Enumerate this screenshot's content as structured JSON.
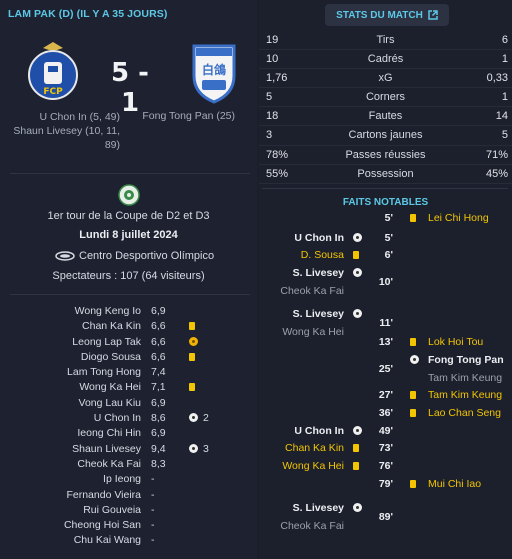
{
  "match": {
    "header": "LAM PAK (D) (IL Y A 35 JOURS)",
    "score": "5 - 1",
    "home_scorers": [
      "U Chon In (5, 49)",
      "Shaun Livesey (10, 11,",
      "89)"
    ],
    "away_scorers": "Fong Tong Pan (25)",
    "home_crest_text": "FCP",
    "away_crest_text": "白鴿",
    "round": "1er tour de la Coupe de D2 et D3",
    "date": "Lundi 8 juillet 2024",
    "venue": "Centro Desportivo Olímpico",
    "spectators": "Spectateurs : 107 (64 visiteurs)"
  },
  "ratings": [
    {
      "name": "Wong Keng Io",
      "rating": "6,9",
      "mark": "",
      "goals": ""
    },
    {
      "name": "Chan Ka Kin",
      "rating": "6,6",
      "mark": "yellow-card",
      "goals": ""
    },
    {
      "name": "Leong Lap Tak",
      "rating": "6,6",
      "mark": "gold-ball",
      "goals": ""
    },
    {
      "name": "Diogo Sousa",
      "rating": "6,6",
      "mark": "yellow-card",
      "goals": ""
    },
    {
      "name": "Lam Tong Hong",
      "rating": "7,4",
      "mark": "",
      "goals": ""
    },
    {
      "name": "Wong Ka Hei",
      "rating": "7,1",
      "mark": "yellow-card",
      "goals": ""
    },
    {
      "name": "Vong Lau Kiu",
      "rating": "6,9",
      "mark": "",
      "goals": ""
    },
    {
      "name": "U Chon In",
      "rating": "8,6",
      "mark": "ball",
      "goals": "2"
    },
    {
      "name": "Ieong Chi Hin",
      "rating": "6,9",
      "mark": "",
      "goals": ""
    },
    {
      "name": "Shaun Livesey",
      "rating": "9,4",
      "mark": "ball",
      "goals": "3"
    },
    {
      "name": "Cheok Ka Fai",
      "rating": "8,3",
      "mark": "",
      "goals": ""
    },
    {
      "name": "Ip Ieong",
      "rating": "-",
      "mark": "",
      "goals": ""
    },
    {
      "name": "Fernando Vieira",
      "rating": "-",
      "mark": "",
      "goals": ""
    },
    {
      "name": "Rui Gouveia",
      "rating": "-",
      "mark": "",
      "goals": ""
    },
    {
      "name": "Cheong Hoi San",
      "rating": "-",
      "mark": "",
      "goals": ""
    },
    {
      "name": "Chu Kai Wang",
      "rating": "-",
      "mark": "",
      "goals": ""
    }
  ],
  "stats_button": "STATS DU MATCH",
  "stats": [
    {
      "home": "19",
      "label": "Tirs",
      "away": "6"
    },
    {
      "home": "10",
      "label": "Cadrés",
      "away": "1"
    },
    {
      "home": "1,76",
      "label": "xG",
      "away": "0,33"
    },
    {
      "home": "5",
      "label": "Corners",
      "away": "1"
    },
    {
      "home": "18",
      "label": "Fautes",
      "away": "14"
    },
    {
      "home": "3",
      "label": "Cartons jaunes",
      "away": "5"
    },
    {
      "home": "78%",
      "label": "Passes réussies",
      "away": "71%"
    },
    {
      "home": "55%",
      "label": "Possession",
      "away": "45%"
    }
  ],
  "notables_title": "FAITS NOTABLES",
  "events": [
    {
      "minute": "5'",
      "home": [],
      "home_icon": "",
      "away": [
        {
          "text": "Lei Chi Hong",
          "style": "yellow"
        }
      ],
      "away_icon": "yellow-card"
    },
    {
      "minute": "5'",
      "home": [
        {
          "text": "U Chon In",
          "style": "white"
        }
      ],
      "home_icon": "ball",
      "away": [],
      "away_icon": ""
    },
    {
      "minute": "6'",
      "home": [
        {
          "text": "D. Sousa",
          "style": "yellow"
        }
      ],
      "home_icon": "yellow-card",
      "away": [],
      "away_icon": ""
    },
    {
      "minute": "10'",
      "home": [
        {
          "text": "S. Livesey",
          "style": "white"
        },
        {
          "text": "Cheok Ka Fai",
          "style": "grey"
        }
      ],
      "home_icon": "ball",
      "away": [],
      "away_icon": ""
    },
    {
      "minute": "11'",
      "home": [
        {
          "text": "S. Livesey",
          "style": "white"
        },
        {
          "text": "Wong Ka Hei",
          "style": "grey"
        }
      ],
      "home_icon": "ball",
      "away": [],
      "away_icon": ""
    },
    {
      "minute": "13'",
      "home": [],
      "home_icon": "",
      "away": [
        {
          "text": "Lok Hoi Tou",
          "style": "yellow"
        }
      ],
      "away_icon": "yellow-card"
    },
    {
      "minute": "25'",
      "home": [],
      "home_icon": "",
      "away": [
        {
          "text": "Fong Tong Pan",
          "style": "white"
        },
        {
          "text": "Tam Kim Keung",
          "style": "grey"
        }
      ],
      "away_icon": "ball"
    },
    {
      "minute": "27'",
      "home": [],
      "home_icon": "",
      "away": [
        {
          "text": "Tam Kim Keung",
          "style": "yellow"
        }
      ],
      "away_icon": "yellow-card"
    },
    {
      "minute": "36'",
      "home": [],
      "home_icon": "",
      "away": [
        {
          "text": "Lao Chan Seng",
          "style": "yellow"
        }
      ],
      "away_icon": "yellow-card"
    },
    {
      "minute": "49'",
      "home": [
        {
          "text": "U Chon In",
          "style": "white"
        }
      ],
      "home_icon": "ball",
      "away": [],
      "away_icon": ""
    },
    {
      "minute": "73'",
      "home": [
        {
          "text": "Chan Ka Kin",
          "style": "yellow"
        }
      ],
      "home_icon": "yellow-card",
      "away": [],
      "away_icon": ""
    },
    {
      "minute": "76'",
      "home": [
        {
          "text": "Wong Ka Hei",
          "style": "yellow"
        }
      ],
      "home_icon": "yellow-card",
      "away": [],
      "away_icon": ""
    },
    {
      "minute": "79'",
      "home": [],
      "home_icon": "",
      "away": [
        {
          "text": "Mui Chi Iao",
          "style": "yellow"
        }
      ],
      "away_icon": "yellow-card"
    },
    {
      "minute": "89'",
      "home": [
        {
          "text": "S. Livesey",
          "style": "white"
        },
        {
          "text": "Cheok Ka Fai",
          "style": "grey"
        }
      ],
      "home_icon": "ball",
      "away": [],
      "away_icon": ""
    }
  ],
  "colors": {
    "accent": "#5cc8e6",
    "yellow": "#f2c500",
    "background": "#1b1f2a"
  }
}
